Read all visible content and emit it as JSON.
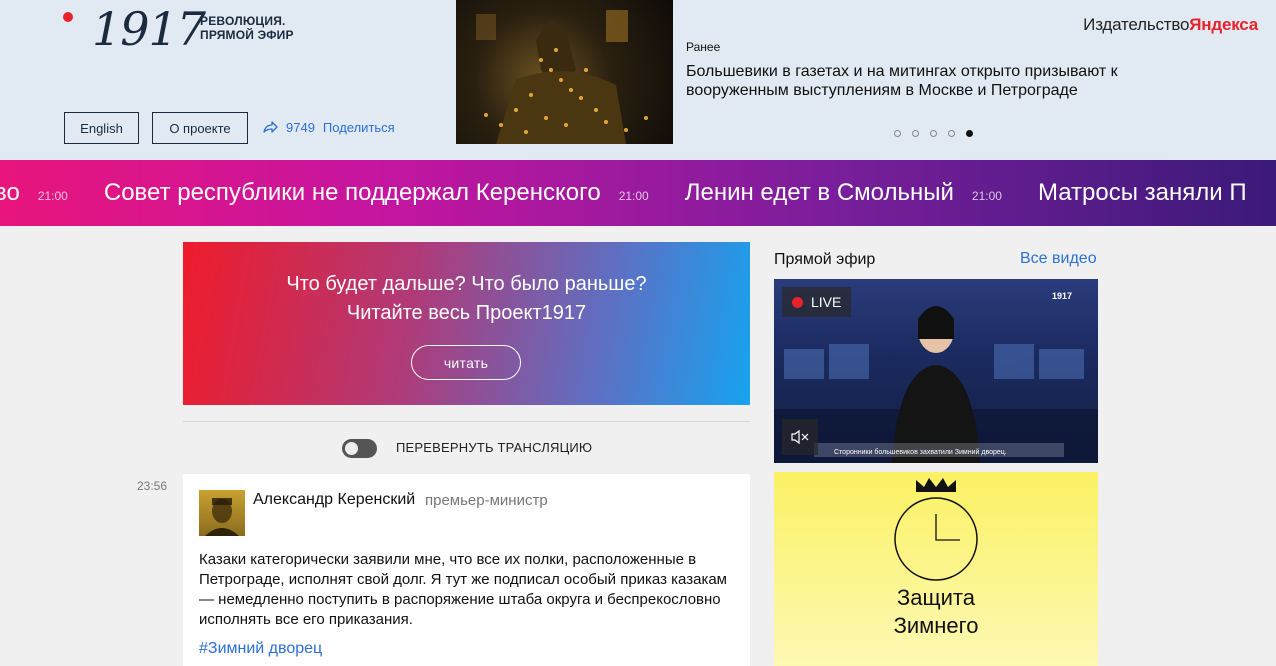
{
  "header": {
    "logo_number": "1917",
    "logo_subtitle_line1": "РЕВОЛЮЦИЯ.",
    "logo_subtitle_line2": "ПРЯМОЙ ЭФИР",
    "english_button": "English",
    "about_button": "О проекте",
    "share_count": "9749",
    "share_label": "Поделиться",
    "publisher_prefix": "Издательство",
    "publisher_brand": "Яндекса",
    "carousel": {
      "label": "Ранее",
      "headline": "Большевики в газетах и на митингах открыто призывают к вооруженным выступлениям в Москве и Петрограде",
      "slides_total": 5,
      "active_slide": 5
    }
  },
  "ticker": {
    "items": [
      {
        "text": "во",
        "time": "21:00"
      },
      {
        "text": "Совет республики не поддержал Керенского",
        "time": "21:00"
      },
      {
        "text": "Ленин едет в Смольный",
        "time": "21:00"
      },
      {
        "text": "Матросы заняли П",
        "time": ""
      }
    ]
  },
  "promo": {
    "line1": "Что будет дальше? Что было раньше?",
    "line2": "Читайте весь Проект1917",
    "button": "читать"
  },
  "feed": {
    "toggle_label": "ПЕРЕВЕРНУТЬ ТРАНСЛЯЦИЮ",
    "posts": [
      {
        "time": "23:56",
        "author": "Александр Керенский",
        "role": "премьер-министр",
        "body": "Казаки категорически заявили мне, что все их полки, расположенные в Петрограде, исполнят свой долг. Я тут же подписал особый приказ казакам — немедленно поступить в распоряжение штаба округа и беспрекословно исполнять все его приказания.",
        "hashtag": "#Зимний дворец"
      }
    ]
  },
  "sidebar": {
    "live_title": "Прямой эфир",
    "all_videos": "Все видео",
    "video": {
      "badge": "LIVE",
      "channel_logo": "1917",
      "caption": "Сторонники большевиков захватили Зимний дворец."
    },
    "card": {
      "title_line1": "Защита",
      "title_line2": "Зимнего"
    }
  },
  "colors": {
    "accent_blue": "#2b6fd6",
    "accent_red": "#e8222b",
    "navy": "#1b2a3f"
  }
}
